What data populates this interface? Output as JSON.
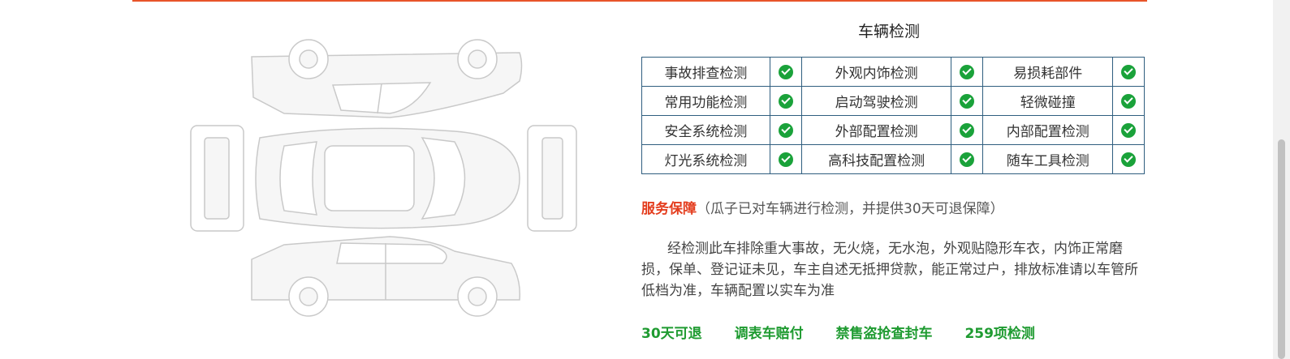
{
  "section": {
    "title": "车辆检测"
  },
  "checks": {
    "rows": [
      [
        {
          "label": "事故排查检测"
        },
        {
          "label": "外观内饰检测"
        },
        {
          "label": "易损耗部件"
        }
      ],
      [
        {
          "label": "常用功能检测"
        },
        {
          "label": "启动驾驶检测"
        },
        {
          "label": "轻微碰撞"
        }
      ],
      [
        {
          "label": "安全系统检测"
        },
        {
          "label": "外部配置检测"
        },
        {
          "label": "内部配置检测"
        }
      ],
      [
        {
          "label": "灯光系统检测"
        },
        {
          "label": "高科技配置检测"
        },
        {
          "label": "随车工具检测"
        }
      ]
    ],
    "icon": "check-circle-icon"
  },
  "guarantee": {
    "title": "服务保障",
    "note": "（瓜子已对车辆进行检测，并提供30天可退保障）"
  },
  "description": "经检测此车排除重大事故，无火烧，无水泡，外观贴隐形车衣，内饰正常磨损，保单、登记证未见，车主自述无抵押贷款，能正常过户，排放标准请以车管所低档为准，车辆配置以实车为准",
  "tags": [
    "30天可退",
    "调表车赔付",
    "禁售盗抢查封车",
    "259项检测"
  ],
  "colors": {
    "accent": "#e8542a",
    "check": "#1aa23a",
    "tag": "#1f9b31",
    "guarantee_title": "#e43d1e",
    "table_border": "#2f5e7f"
  }
}
